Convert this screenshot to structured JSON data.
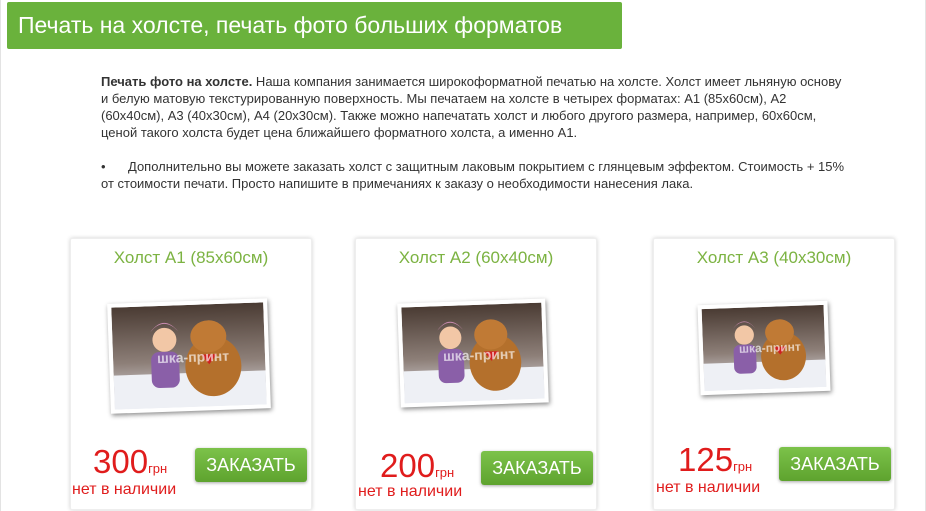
{
  "header": {
    "title": "Печать на холсте, печать фото больших форматов"
  },
  "description": {
    "lead": "Печать фото на холсте.",
    "body": " Наша компания занимается широкоформатной печатью на холсте. Холст имеет льняную основу и белую матовую текстурированную поверхность. Мы печатаем на холсте в четырех форматах: А1 (85x60см), А2 (60x40см), А3 (40x30см), А4 (20x30см). Также можно напечатать холст и любого другого размера, например, 60x60см, ценой такого холста будет цена ближайшего форматного холста, а именно А1.",
    "bullet": "•",
    "note": "Дополнительно вы можете заказать холст с защитным лаковым покрытием с глянцевым эффектом. Стоимость  + 15% от стоимости печати. Просто напишите в примечаниях к заказу о необходимости нанесения лака."
  },
  "products": [
    {
      "title": "Холст А1 (85x60см)",
      "price": "300",
      "currency": "грн",
      "stock": "нет в наличии",
      "button": "ЗАКАЗАТЬ",
      "watermark": "шка-принт"
    },
    {
      "title": "Холст А2 (60x40см)",
      "price": "200",
      "currency": "грн",
      "stock": "нет в наличии",
      "button": "ЗАКАЗАТЬ",
      "watermark": "шка-принт"
    },
    {
      "title": "Холст А3 (40x30см)",
      "price": "125",
      "currency": "грн",
      "stock": "нет в наличии",
      "button": "ЗАКАЗАТЬ",
      "watermark": "шка-принт"
    }
  ],
  "colors": {
    "accent": "#6ab23c",
    "title_green": "#7cb342",
    "price_red": "#e01c1c"
  }
}
